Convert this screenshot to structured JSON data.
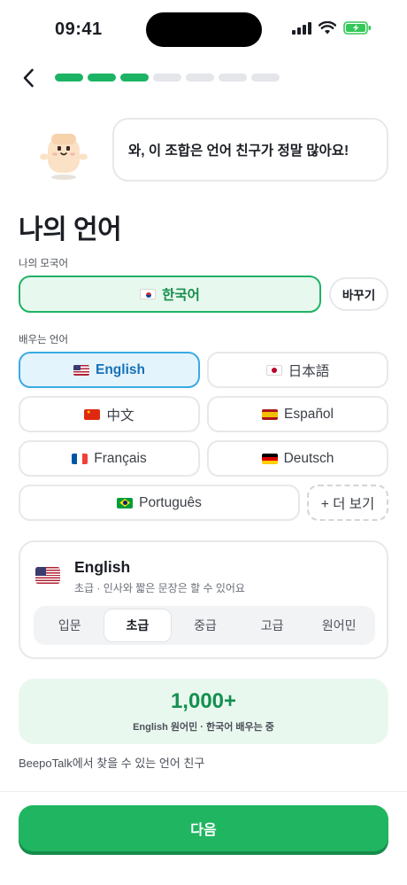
{
  "status_bar": {
    "time": "09:41"
  },
  "progress": {
    "total_steps": 7,
    "completed_steps": 3
  },
  "bubble": {
    "text": "와, 이 조합은 언어 친구가 정말 많아요!"
  },
  "page_title": "나의 언어",
  "native": {
    "label": "나의 모국어",
    "language": "한국어",
    "flag": "kr-flag",
    "change_label": "바꾸기"
  },
  "learning": {
    "label": "배우는 언어",
    "languages": [
      {
        "name": "English",
        "flag": "us-flag",
        "selected": true
      },
      {
        "name": "日本語",
        "flag": "jp-flag",
        "selected": false
      },
      {
        "name": "中文",
        "flag": "cn-flag",
        "selected": false
      },
      {
        "name": "Español",
        "flag": "es-flag",
        "selected": false
      },
      {
        "name": "Français",
        "flag": "fr-flag",
        "selected": false
      },
      {
        "name": "Deutsch",
        "flag": "de-flag",
        "selected": false
      },
      {
        "name": "Português",
        "flag": "br-flag",
        "selected": false
      }
    ],
    "more_label": "+ 더 보기"
  },
  "level_card": {
    "language": "English",
    "description": "초급 · 인사와 짧은 문장은 할 수 있어요",
    "levels": [
      "입문",
      "초급",
      "중급",
      "고급",
      "원어민"
    ],
    "selected_level": "초급"
  },
  "stat": {
    "number": "1,000+",
    "subtitle": "English 원어민 · 한국어 배우는 중"
  },
  "footnote": "BeepoTalk에서 찾을 수 있는 언어 친구",
  "next_button": "다음",
  "colors": {
    "primary_green": "#1fb561",
    "selected_blue": "#3aaae3",
    "native_bg": "#e7f8ee"
  }
}
